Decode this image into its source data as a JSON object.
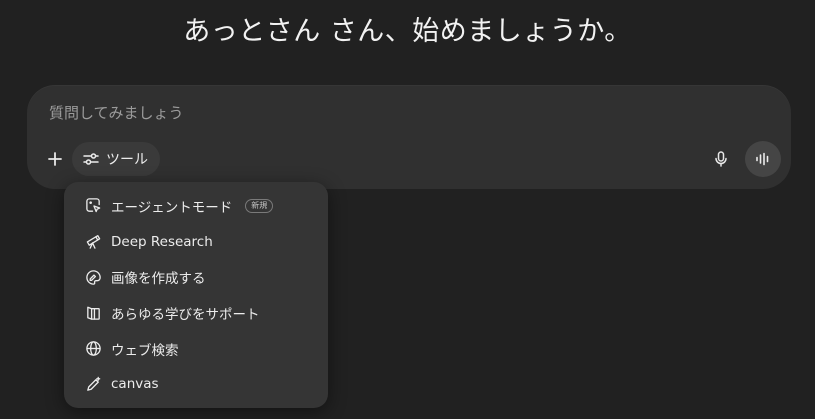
{
  "greeting": "あっとさん さん、始めましょうか。",
  "composer": {
    "placeholder": "質問してみましょう",
    "value": "",
    "tools_label": "ツール"
  },
  "menu": {
    "items": [
      {
        "label": "エージェントモード",
        "icon": "agent-cursor-icon",
        "badge": "新規"
      },
      {
        "label": "Deep Research",
        "icon": "telescope-icon"
      },
      {
        "label": "画像を作成する",
        "icon": "palette-icon"
      },
      {
        "label": "あらゆる学びをサポート",
        "icon": "book-icon"
      },
      {
        "label": "ウェブ検索",
        "icon": "globe-icon"
      },
      {
        "label": "canvas",
        "icon": "pen-sparkle-icon"
      }
    ]
  },
  "colors": {
    "background": "#212121",
    "composer": "#303030",
    "menu": "#353535",
    "text": "#ececec",
    "placeholder": "#9b9b9b"
  }
}
